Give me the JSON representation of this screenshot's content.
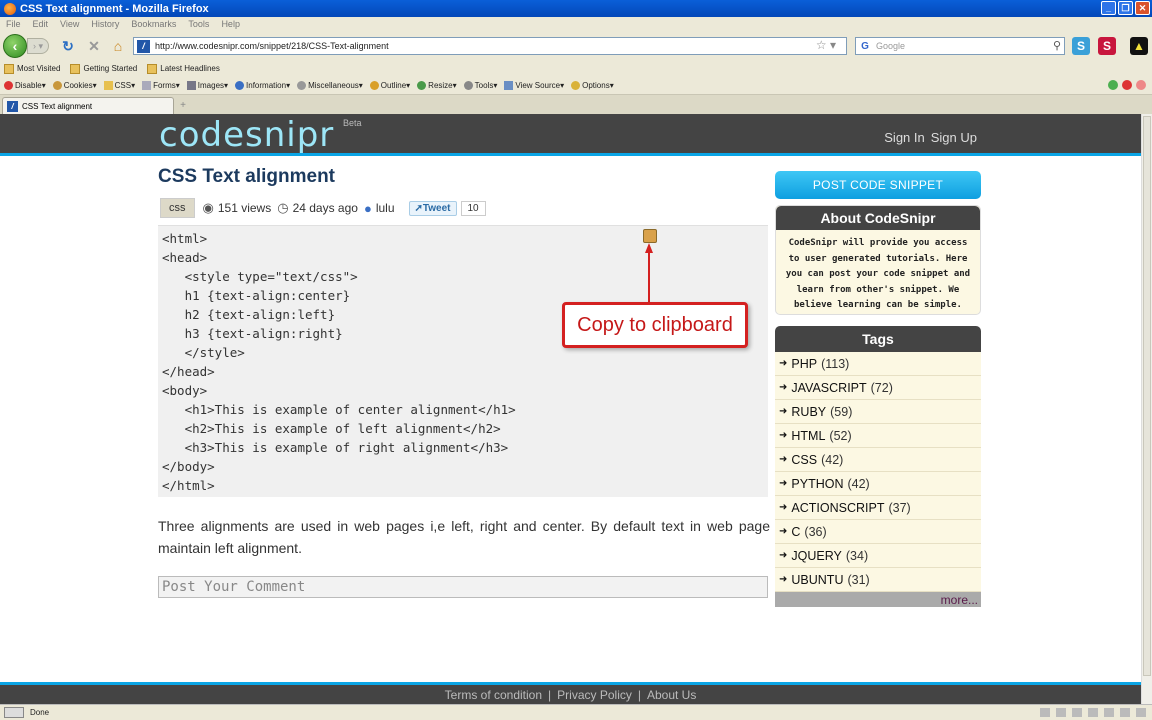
{
  "window": {
    "title": "CSS Text alignment - Mozilla Firefox"
  },
  "menu": [
    "File",
    "Edit",
    "View",
    "History",
    "Bookmarks",
    "Tools",
    "Help"
  ],
  "nav": {
    "url": "http://www.codesnipr.com/snippet/218/CSS-Text-alignment",
    "search_placeholder": "Google"
  },
  "bookmarks": [
    "Most Visited",
    "Getting Started",
    "Latest Headlines"
  ],
  "devbar": [
    "Disable",
    "Cookies",
    "CSS",
    "Forms",
    "Images",
    "Information",
    "Miscellaneous",
    "Outline",
    "Resize",
    "Tools",
    "View Source",
    "Options"
  ],
  "tab": {
    "title": "CSS Text alignment"
  },
  "site": {
    "logo": "codesnipr",
    "logo_badge": "Beta",
    "sign_in": "Sign In",
    "sign_up": "Sign Up"
  },
  "post": {
    "title": "CSS Text alignment",
    "tag": "css",
    "views": "151 views",
    "age": "24 days ago",
    "author": "lulu",
    "tweet_label": "Tweet",
    "tweet_count": "10",
    "code": [
      "<html>",
      "<head>",
      "   <style type=\"text/css\">",
      "   h1 {text-align:center}",
      "   h2 {text-align:left}",
      "   h3 {text-align:right}",
      "   </style>",
      "</head>",
      "<body>",
      "   <h1>This is example of center alignment</h1>",
      "   <h2>This is example of left alignment</h2>",
      "   <h3>This is example of right alignment</h3>",
      "</body>",
      "</html>"
    ],
    "callout": "Copy to clipboard",
    "body": "Three alignments are used in web pages i,e left, right and center. By default text in web page maintain left alignment.",
    "comment_placeholder": "Post Your Comment"
  },
  "sidebar": {
    "post_button": "POST CODE SNIPPET",
    "about_title": "About CodeSnipr",
    "about_text": "CodeSnipr will provide you access to user generated tutorials. Here you can post your code snippet and learn from other's snippet. We believe learning can be simple.",
    "tags_title": "Tags",
    "tags": [
      {
        "name": "PHP",
        "count": "(113)"
      },
      {
        "name": "JAVASCRIPT",
        "count": "(72)"
      },
      {
        "name": "RUBY",
        "count": "(59)"
      },
      {
        "name": "HTML",
        "count": "(52)"
      },
      {
        "name": "CSS",
        "count": "(42)"
      },
      {
        "name": "PYTHON",
        "count": "(42)"
      },
      {
        "name": "ACTIONSCRIPT",
        "count": "(37)"
      },
      {
        "name": "C",
        "count": "(36)"
      },
      {
        "name": "JQUERY",
        "count": "(34)"
      },
      {
        "name": "UBUNTU",
        "count": "(31)"
      }
    ],
    "more": "more..."
  },
  "footer": {
    "terms": "Terms of condition",
    "privacy": "Privacy Policy",
    "about": "About Us"
  },
  "status": {
    "text": "Done"
  },
  "colors": {
    "accent": "#0aa5e6",
    "header_bg": "#444444",
    "title": "#1c3a5e",
    "callout": "#d42020"
  }
}
